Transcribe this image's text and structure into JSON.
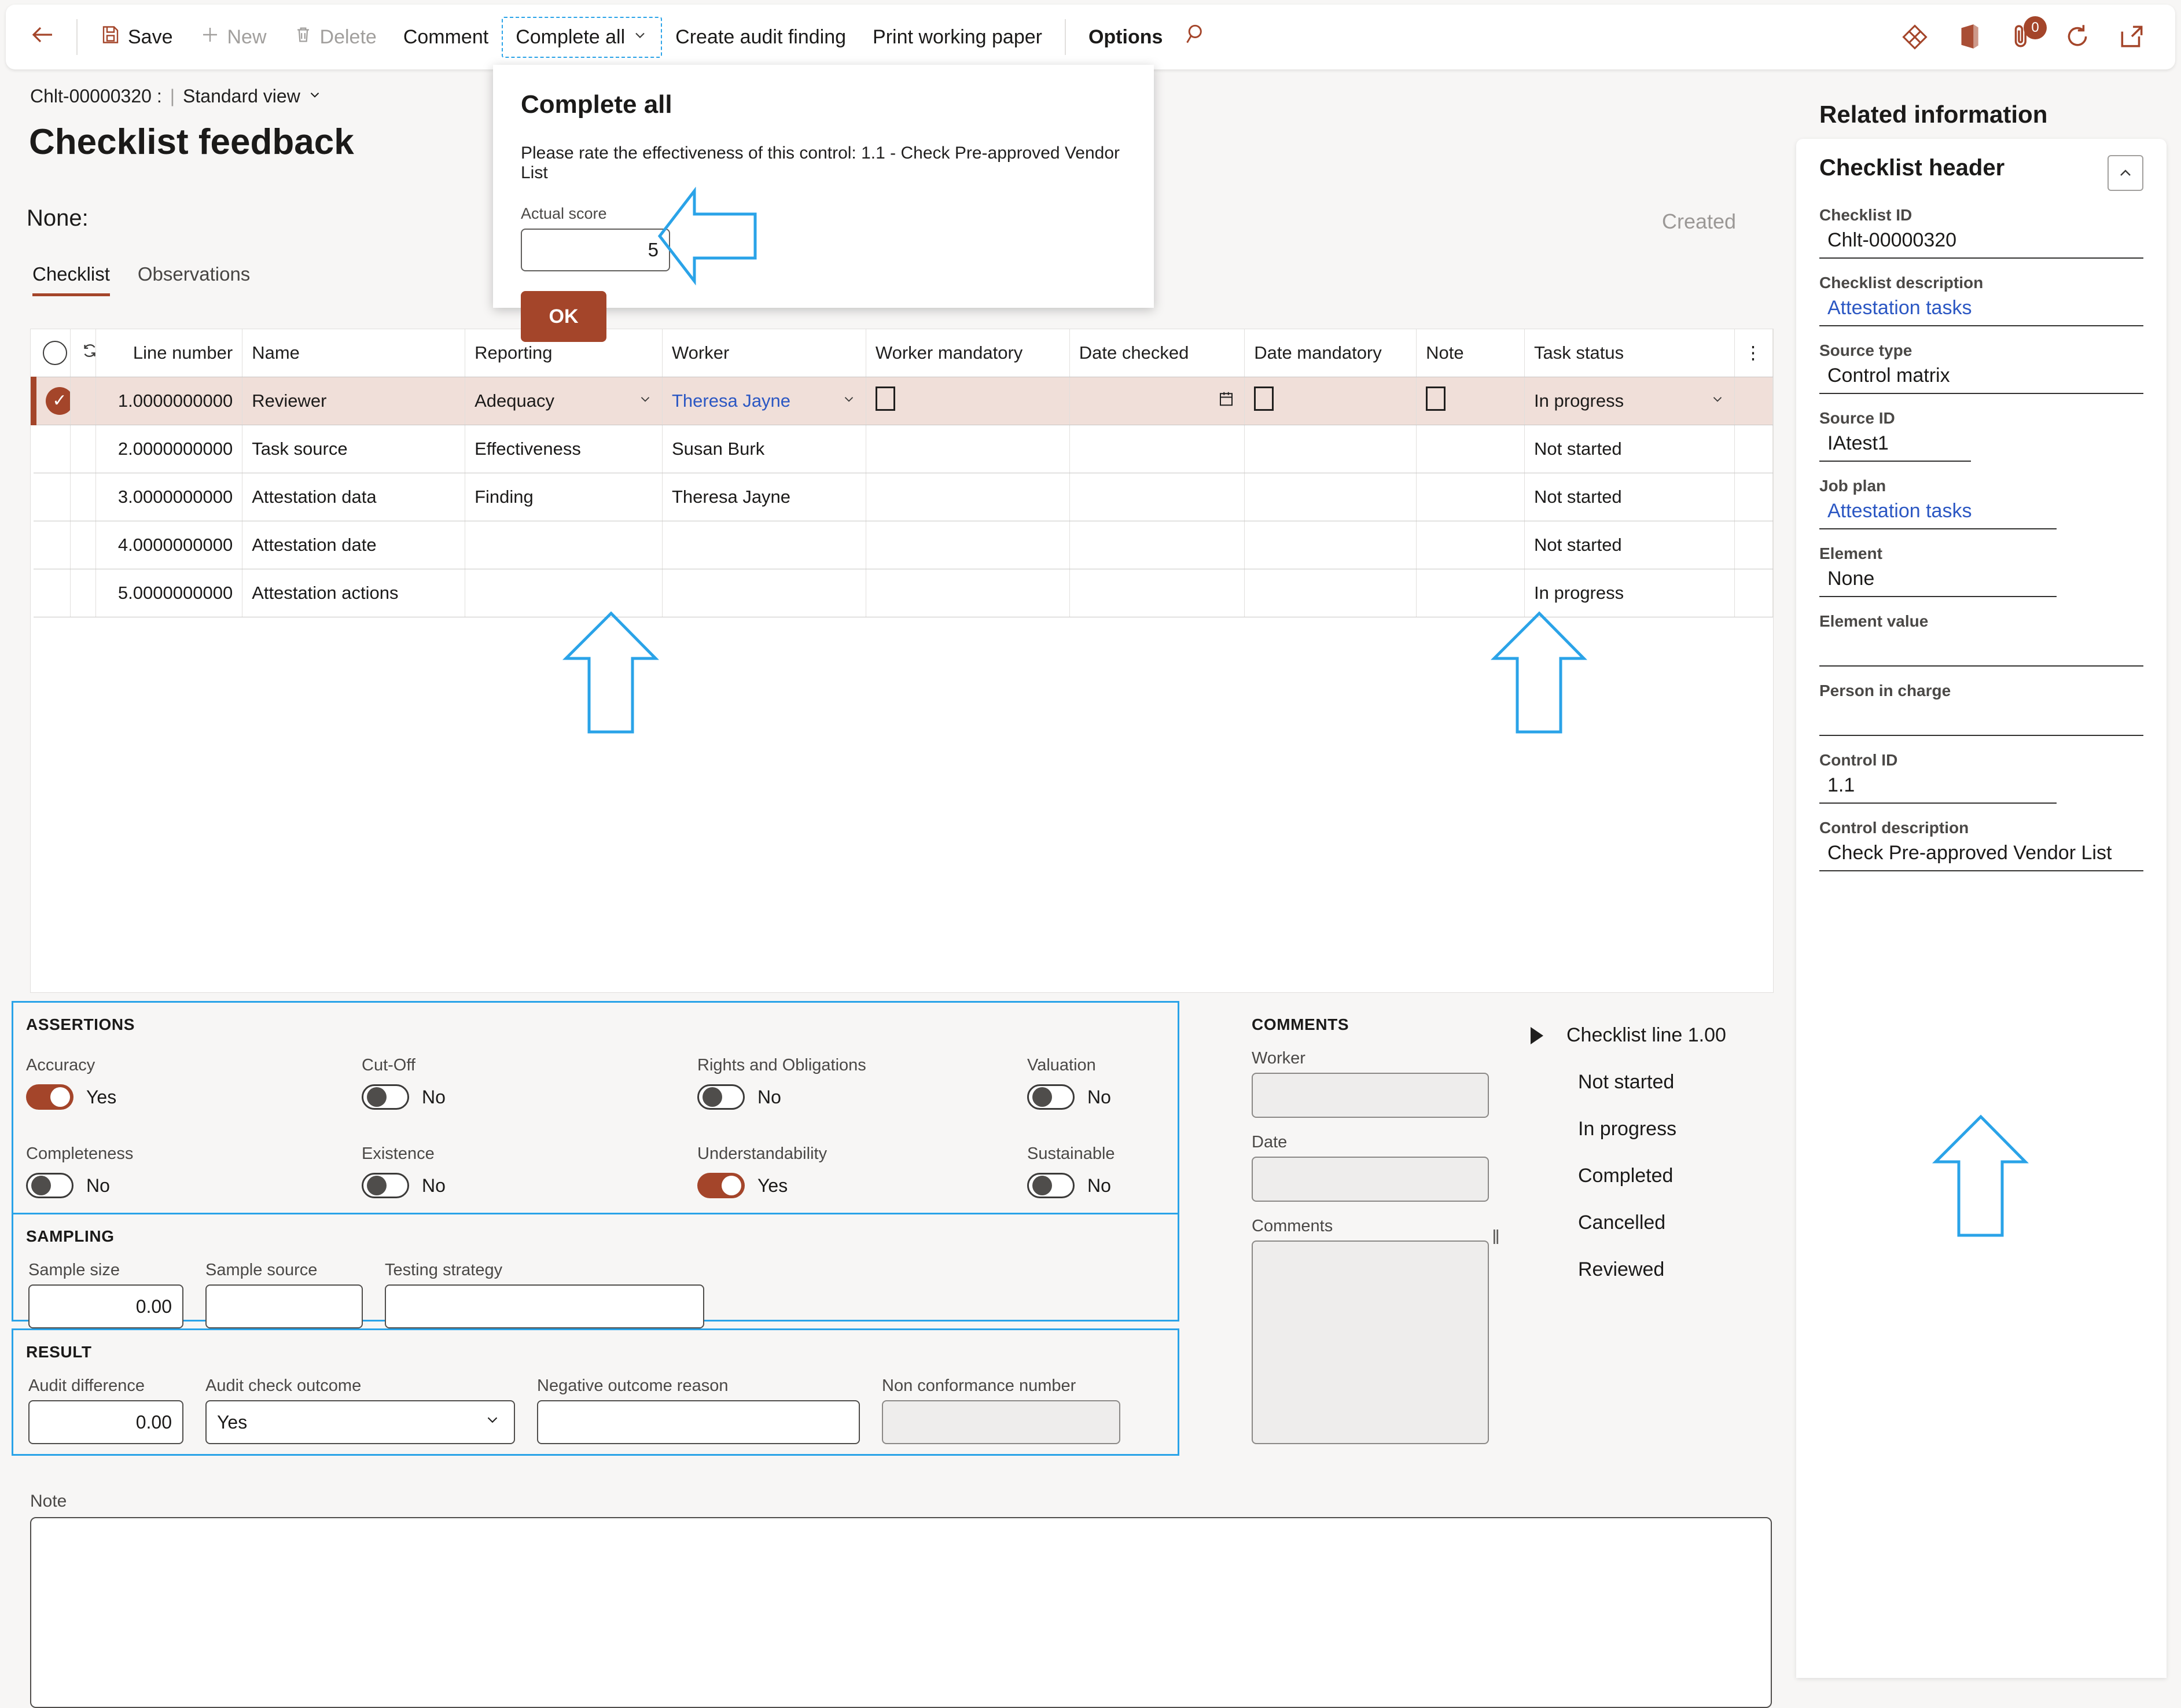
{
  "commandbar": {
    "back_label": "←",
    "buttons": [
      {
        "label": "Save",
        "icon": "save-icon",
        "state": "enabled"
      },
      {
        "label": "New",
        "icon": "plus-icon",
        "state": "disabled"
      },
      {
        "label": "Delete",
        "icon": "trash-icon",
        "state": "disabled"
      },
      {
        "label": "Comment",
        "icon": "",
        "state": "enabled"
      },
      {
        "label": "Complete all",
        "icon": "chevron-down-icon",
        "state": "focused"
      },
      {
        "label": "Create audit finding",
        "icon": "",
        "state": "enabled"
      },
      {
        "label": "Print working paper",
        "icon": "",
        "state": "enabled"
      },
      {
        "label": "Options",
        "icon": "",
        "state": "enabled"
      }
    ],
    "search_icon": "search-icon",
    "right_icons": [
      {
        "name": "dynamics-diamond-icon"
      },
      {
        "name": "office-app-launcher-icon"
      },
      {
        "name": "attachment-icon",
        "badge": "0"
      },
      {
        "name": "refresh-icon"
      },
      {
        "name": "open-in-new-window-icon"
      }
    ]
  },
  "flyout": {
    "title": "Complete all",
    "prompt": "Please rate the effectiveness of this control: 1.1 - Check Pre-approved Vendor List",
    "score_label": "Actual score",
    "score_value": "5",
    "ok_label": "OK"
  },
  "header": {
    "record_id": "Chlt-00000320 :",
    "separator": "|",
    "view": "Standard view",
    "title": "Checklist feedback",
    "subtitle": "None:",
    "status": "Created"
  },
  "tabs": [
    {
      "label": "Checklist",
      "active": true
    },
    {
      "label": "Observations",
      "active": false
    }
  ],
  "grid": {
    "columns": [
      "",
      "",
      "Line number",
      "Name",
      "Reporting",
      "Worker",
      "Worker mandatory",
      "Date checked",
      "Date mandatory",
      "Note",
      "Task status",
      ""
    ],
    "rows": [
      {
        "selected": true,
        "line_number": "1.0000000000",
        "name": "Reviewer",
        "reporting": "Adequacy",
        "worker": "Theresa Jayne",
        "worker_is_link": true,
        "worker_mandatory": "unchecked",
        "date_checked": "",
        "date_checked_icon": "calendar-icon",
        "date_mandatory": "unchecked",
        "note": "unchecked",
        "task_status": "In progress",
        "status_has_dropdown": true
      },
      {
        "selected": false,
        "line_number": "2.0000000000",
        "name": "Task source",
        "reporting": "Effectiveness",
        "worker": "Susan Burk",
        "worker_is_link": false,
        "worker_mandatory": "",
        "date_checked": "",
        "date_mandatory": "",
        "note": "",
        "task_status": "Not started",
        "status_has_dropdown": false
      },
      {
        "selected": false,
        "line_number": "3.0000000000",
        "name": "Attestation data",
        "reporting": "Finding",
        "worker": "Theresa Jayne",
        "worker_is_link": false,
        "worker_mandatory": "",
        "date_checked": "",
        "date_mandatory": "",
        "note": "",
        "task_status": "Not started",
        "status_has_dropdown": false
      },
      {
        "selected": false,
        "line_number": "4.0000000000",
        "name": "Attestation date",
        "reporting": "",
        "worker": "",
        "worker_is_link": false,
        "worker_mandatory": "",
        "date_checked": "",
        "date_mandatory": "",
        "note": "",
        "task_status": "Not started",
        "status_has_dropdown": false
      },
      {
        "selected": false,
        "line_number": "5.0000000000",
        "name": "Attestation actions",
        "reporting": "",
        "worker": "",
        "worker_is_link": false,
        "worker_mandatory": "",
        "date_checked": "",
        "date_mandatory": "",
        "note": "",
        "task_status": "In progress",
        "status_has_dropdown": false
      }
    ]
  },
  "assertions": {
    "title": "ASSERTIONS",
    "items": [
      {
        "label": "Accuracy",
        "value": "Yes",
        "on": true
      },
      {
        "label": "Cut-Off",
        "value": "No",
        "on": false
      },
      {
        "label": "Rights and Obligations",
        "value": "No",
        "on": false
      },
      {
        "label": "Valuation",
        "value": "No",
        "on": false
      },
      {
        "label": "Completeness",
        "value": "No",
        "on": false
      },
      {
        "label": "Existence",
        "value": "No",
        "on": false
      },
      {
        "label": "Understandability",
        "value": "Yes",
        "on": true
      },
      {
        "label": "Sustainable",
        "value": "No",
        "on": false
      }
    ]
  },
  "sampling": {
    "title": "SAMPLING",
    "sample_size_label": "Sample size",
    "sample_size_value": "0.00",
    "sample_source_label": "Sample source",
    "sample_source_value": "",
    "testing_strategy_label": "Testing strategy",
    "testing_strategy_value": ""
  },
  "result": {
    "title": "RESULT",
    "audit_difference_label": "Audit difference",
    "audit_difference_value": "0.00",
    "audit_check_outcome_label": "Audit check outcome",
    "audit_check_outcome_value": "Yes",
    "negative_outcome_reason_label": "Negative outcome reason",
    "negative_outcome_reason_value": "",
    "non_conformance_number_label": "Non conformance number",
    "non_conformance_number_value": ""
  },
  "comments": {
    "title": "COMMENTS",
    "worker_label": "Worker",
    "worker_value": "",
    "date_label": "Date",
    "date_value": "",
    "comments_label": "Comments",
    "comments_value": ""
  },
  "status_list": {
    "head": "Checklist line 1.00",
    "items": [
      "Not started",
      "In progress",
      "Completed",
      "Cancelled",
      "Reviewed"
    ]
  },
  "note": {
    "label": "Note",
    "value": ""
  },
  "related": {
    "pane_title": "Related information",
    "card_title": "Checklist header",
    "fields": [
      {
        "label": "Checklist ID",
        "value": "Chlt-00000320",
        "link": false
      },
      {
        "label": "Checklist description",
        "value": "Attestation tasks",
        "link": true
      },
      {
        "label": "Source type",
        "value": "Control matrix",
        "link": false
      },
      {
        "label": "Source ID",
        "value": "IAtest1",
        "link": false
      },
      {
        "label": "Job plan",
        "value": "Attestation tasks",
        "link": true
      },
      {
        "label": "Element",
        "value": "None",
        "link": false
      },
      {
        "label": "Element value",
        "value": "",
        "link": false
      },
      {
        "label": "Person in charge",
        "value": "",
        "link": false
      },
      {
        "label": "Control ID",
        "value": "1.1",
        "link": false
      },
      {
        "label": "Control description",
        "value": "Check Pre-approved Vendor List",
        "link": false
      }
    ]
  },
  "colors": {
    "accent": "#a4452a",
    "selected_row": "#f0dfd9",
    "annotation": "#2aa3e8",
    "link": "#2b57c3",
    "page_bg": "#f7f6f5"
  }
}
